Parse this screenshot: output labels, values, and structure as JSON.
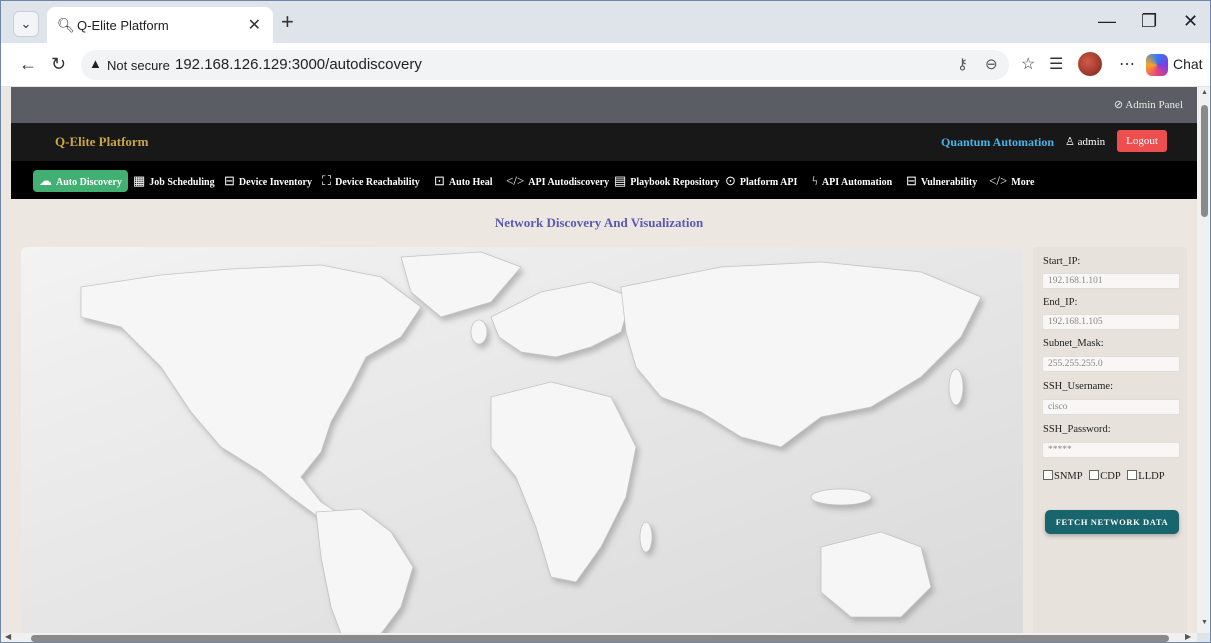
{
  "browser": {
    "tab_title": "Q-Elite Platform",
    "security_label": "Not secure",
    "url": "192.168.126.129:3000/autodiscovery",
    "chat_label": "Chat"
  },
  "app": {
    "admin_link": "Admin Panel",
    "brand": "Q-Elite Platform",
    "org_link": "Quantum Automation",
    "user": "admin",
    "logout": "Logout",
    "nav": [
      {
        "label": "Auto Discovery",
        "icon": "cloud-icon"
      },
      {
        "label": "Job Scheduling",
        "icon": "calendar-icon"
      },
      {
        "label": "Device Inventory",
        "icon": "hard-drive-icon"
      },
      {
        "label": "Device Reachability",
        "icon": "network-icon"
      },
      {
        "label": "Auto Heal",
        "icon": "pulse-icon"
      },
      {
        "label": "API Autodiscovery",
        "icon": "code-icon"
      },
      {
        "label": "Playbook Repository",
        "icon": "book-icon"
      },
      {
        "label": "Platform API",
        "icon": "bug-icon"
      },
      {
        "label": "API Automation",
        "icon": "lightning-icon"
      },
      {
        "label": "Vulnerability",
        "icon": "hard-drive-icon"
      },
      {
        "label": "More",
        "icon": "code-icon"
      }
    ],
    "page_title": "Network Discovery And Visualization"
  },
  "form": {
    "start_ip": {
      "label": "Start_IP:",
      "value": "192.168.1.101"
    },
    "end_ip": {
      "label": "End_IP:",
      "value": "192.168.1.105"
    },
    "subnet_mask": {
      "label": "Subnet_Mask:",
      "value": "255.255.255.0"
    },
    "ssh_username": {
      "label": "SSH_Username:",
      "value": "cisco"
    },
    "ssh_password": {
      "label": "SSH_Password:",
      "value": "*****"
    },
    "protocols": [
      "SNMP",
      "CDP",
      "LLDP"
    ],
    "fetch_label": "FETCH NETWORK DATA"
  },
  "colors": {
    "active_nav": "#43b073",
    "logout": "#ef4e4e",
    "fetch_button": "#19656d",
    "brand_gold": "#c9a54a",
    "page_title": "#5a59b3"
  }
}
